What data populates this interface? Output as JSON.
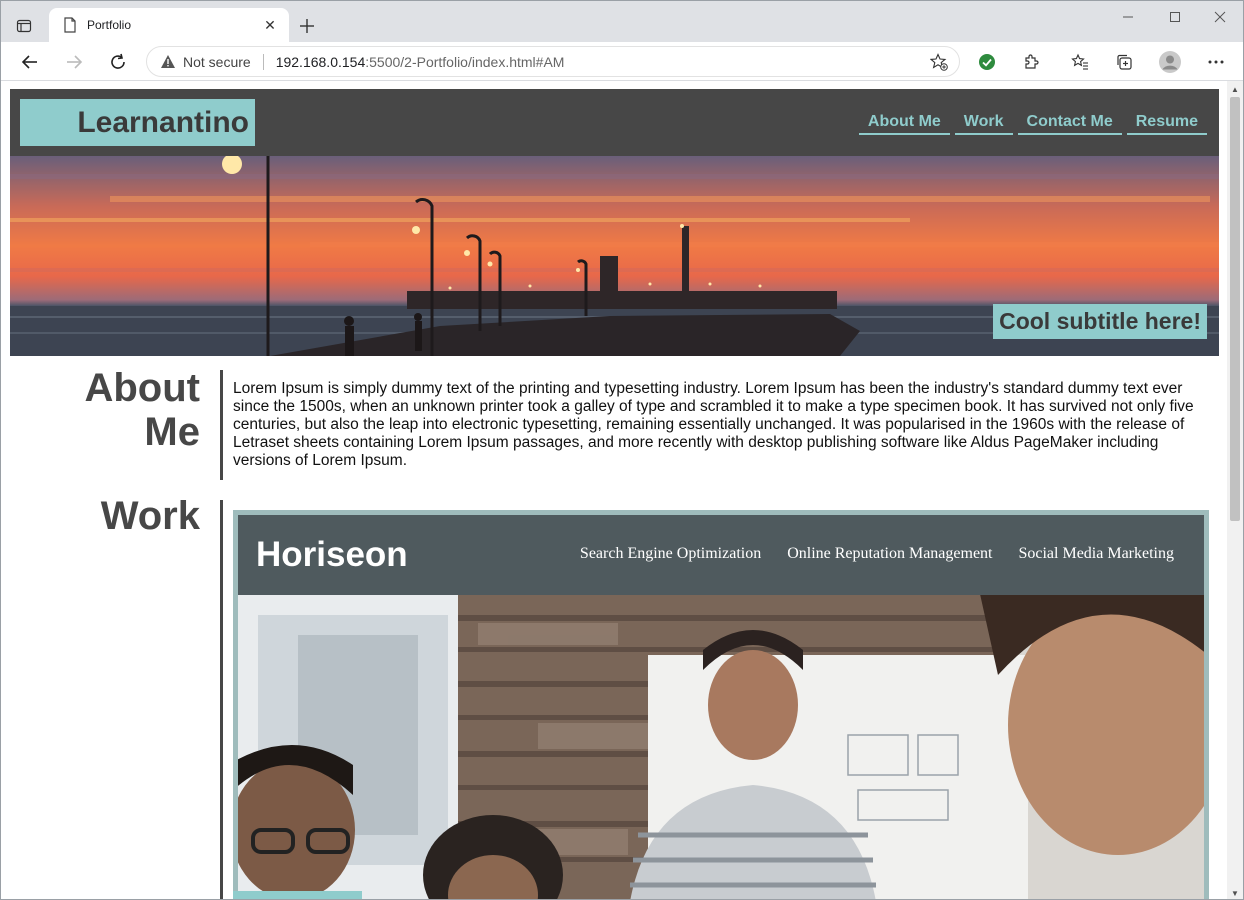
{
  "browser": {
    "tab_title": "Portfolio",
    "security_label": "Not secure",
    "url_host": "192.168.0.154",
    "url_rest": ":5500/2-Portfolio/index.html#AM"
  },
  "site": {
    "logo": "Learnantino",
    "nav": [
      {
        "label": "About Me"
      },
      {
        "label": "Work"
      },
      {
        "label": "Contact Me"
      },
      {
        "label": "Resume"
      }
    ],
    "hero_subtitle": "Cool subtitle here!"
  },
  "about": {
    "title": "About Me",
    "title_line1": "About",
    "title_line2": "Me",
    "body": "Lorem Ipsum is simply dummy text of the printing and typesetting industry. Lorem Ipsum has been the industry's standard dummy text ever since the 1500s, when an unknown printer took a galley of type and scrambled it to make a type specimen book. It has survived not only five centuries, but also the leap into electronic typesetting, remaining essentially unchanged. It was popularised in the 1960s with the release of Letraset sheets containing Lorem Ipsum passages, and more recently with desktop publishing software like Aldus PageMaker including versions of Lorem Ipsum."
  },
  "work": {
    "title": "Work",
    "project": {
      "logo": "Horiseon",
      "nav": [
        "Search Engine Optimization",
        "Online Reputation Management",
        "Social Media Marketing"
      ]
    }
  },
  "colors": {
    "accent": "#8fcccc",
    "header_bg": "#474747",
    "text_dark": "#474747"
  }
}
